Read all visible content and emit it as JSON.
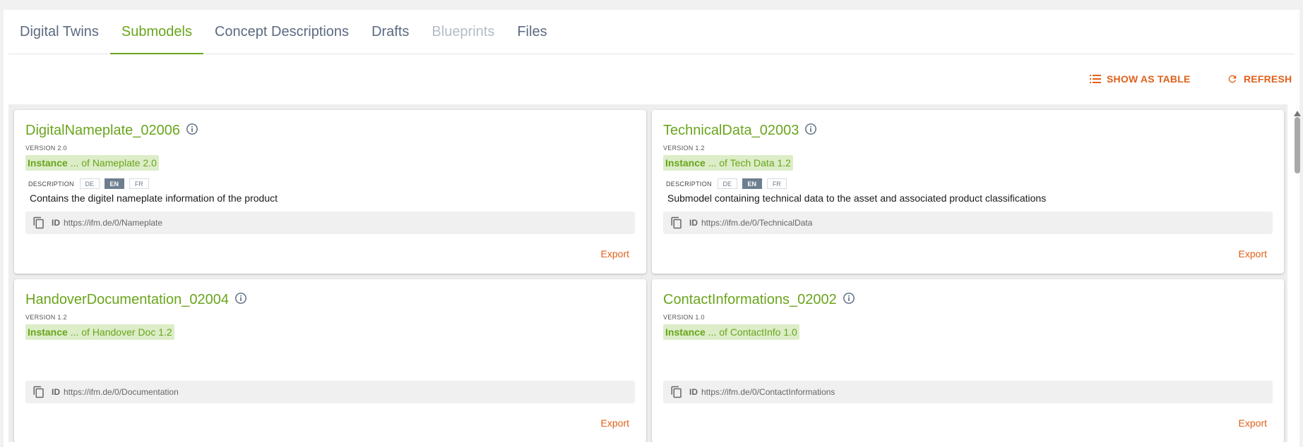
{
  "tabs": [
    {
      "label": "Digital Twins"
    },
    {
      "label": "Submodels"
    },
    {
      "label": "Concept Descriptions"
    },
    {
      "label": "Drafts"
    },
    {
      "label": "Blueprints"
    },
    {
      "label": "Files"
    }
  ],
  "active_tab": "Submodels",
  "toolbar": {
    "show_as_table": "SHOW AS TABLE",
    "refresh": "REFRESH"
  },
  "colors": {
    "accent_green": "#6aa51c",
    "action_orange": "#e0601a",
    "instance_bg": "#dcedc8"
  },
  "cards": [
    {
      "name": "DigitalNameplate_02006",
      "version": "VERSION 2.0",
      "instance_lead": "Instance",
      "instance_rest": " ... of Nameplate 2.0",
      "description_label": "DESCRIPTION",
      "langs": [
        "DE",
        "EN",
        "FR"
      ],
      "active_lang": "EN",
      "description": "Contains the digitel nameplate information of the product",
      "id_label": "ID",
      "id": "https://ifm.de/0/Nameplate",
      "export": "Export"
    },
    {
      "name": "TechnicalData_02003",
      "version": "VERSION 1.2",
      "instance_lead": "Instance",
      "instance_rest": " ... of Tech Data 1.2",
      "description_label": "DESCRIPTION",
      "langs": [
        "DE",
        "EN",
        "FR"
      ],
      "active_lang": "EN",
      "description": "Submodel containing technical data to the asset and associated product classifications",
      "id_label": "ID",
      "id": "https://ifm.de/0/TechnicalData",
      "export": "Export"
    },
    {
      "name": "HandoverDocumentation_02004",
      "version": "VERSION 1.2",
      "instance_lead": "Instance",
      "instance_rest": " ... of Handover Doc 1.2",
      "id_label": "ID",
      "id": "https://ifm.de/0/Documentation",
      "export": "Export"
    },
    {
      "name": "ContactInformations_02002",
      "version": "VERSION 1.0",
      "instance_lead": "Instance",
      "instance_rest": " ... of ContactInfo 1.0",
      "id_label": "ID",
      "id": "https://ifm.de/0/ContactInformations",
      "export": "Export"
    }
  ]
}
